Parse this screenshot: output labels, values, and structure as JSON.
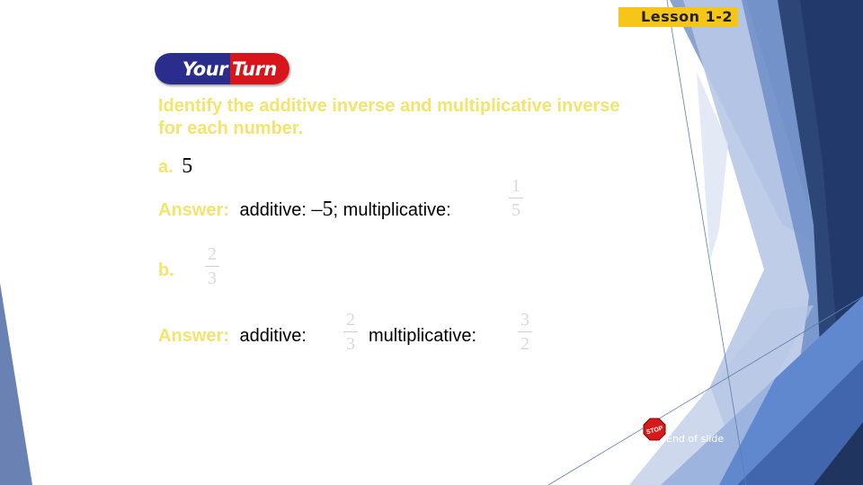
{
  "header": {
    "lesson_badge": "Lesson 1-2",
    "your_turn_left": "Your",
    "your_turn_right": "Turn"
  },
  "prompt": {
    "line1": "Identify the additive inverse and multiplicative inverse",
    "line2": "for each number."
  },
  "items": [
    {
      "label": "a.",
      "number": "5",
      "answer_label": "Answer:",
      "additive_label": "additive:",
      "additive_value": "–5",
      "separator": ";",
      "multiplicative_label": "multiplicative:",
      "multiplicative_value": {
        "numerator": "1",
        "denominator": "5"
      }
    },
    {
      "label": "b.",
      "number": {
        "numerator": "2",
        "denominator": "3"
      },
      "answer_label": "Answer:",
      "additive_label": "additive:",
      "additive_value": {
        "sign": "–",
        "numerator": "2",
        "denominator": "3"
      },
      "separator": ";",
      "multiplicative_label": "multiplicative:",
      "multiplicative_value": {
        "numerator": "3",
        "denominator": "2"
      }
    }
  ],
  "footer": {
    "stop_icon_text": "STOP",
    "end_of_slide": "End of slide"
  },
  "colors": {
    "accent_yellow": "#f3e46c",
    "badge_yellow": "#f5c518",
    "your_blue": "#2b2d8c",
    "turn_red": "#d8151b",
    "theme_blue_dark": "#22396b",
    "theme_blue_mid": "#5f88cf",
    "theme_blue_light": "#b7c9e8"
  }
}
